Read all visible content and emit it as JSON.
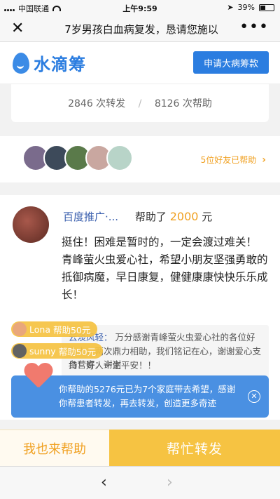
{
  "status_bar": {
    "carrier": "中国联通",
    "time": "上午9:59",
    "battery": "39%",
    "battery_level": 0.39
  },
  "navbar": {
    "title": "7岁男孩白血病复发，恳请您施以",
    "close_icon": "close-icon",
    "more_icon": "more-icon"
  },
  "brand": {
    "logo_text": "水滴筹",
    "apply_button": "申请大病筹款"
  },
  "stats": {
    "shares": "2846 次转发",
    "separator": "/",
    "helps": "8126 次帮助"
  },
  "friends": {
    "link_text": "5位好友已帮助",
    "avatar_colors": [
      "#7a6b8c",
      "#3d4a5a",
      "#5a7a4a",
      "#c9a7a0",
      "#b8d4c8"
    ]
  },
  "donation": {
    "donor_name": "百度推广·...",
    "helped_text": "帮助了",
    "amount": "2000",
    "unit": "元",
    "message": "挺住！困难是暂时的，一定会渡过难关！ 青峰萤火虫爱心社，希望小朋友坚强勇敢的抵御病魔，早日康复，健健康康快快乐乐成长！",
    "reply_name": "云淡风轻：",
    "reply_text": "万分感谢青峰萤火虫爱心社的各位好心人，两次鼎力相助，我们铭记在心，谢谢爱心支持！好人一生平安！！",
    "reply2_name": "刍",
    "reply2": "刍营寄：谢谢"
  },
  "toasts": [
    {
      "name": "Lona",
      "text": "帮助50元"
    },
    {
      "name": "sunny",
      "text": "帮助50元"
    }
  ],
  "notice": {
    "text": "你帮助的5276元已为7个家庭带去希望，感谢你帮患者转发，再去转发，创造更多奇迹"
  },
  "actions": {
    "help_label": "我也来帮助",
    "share_label": "帮忙转发"
  },
  "browser": {
    "back": "‹",
    "forward": "›"
  },
  "colors": {
    "brand_blue": "#2b7de0",
    "accent_orange": "#f0a020",
    "share_yellow": "#f6c342"
  }
}
